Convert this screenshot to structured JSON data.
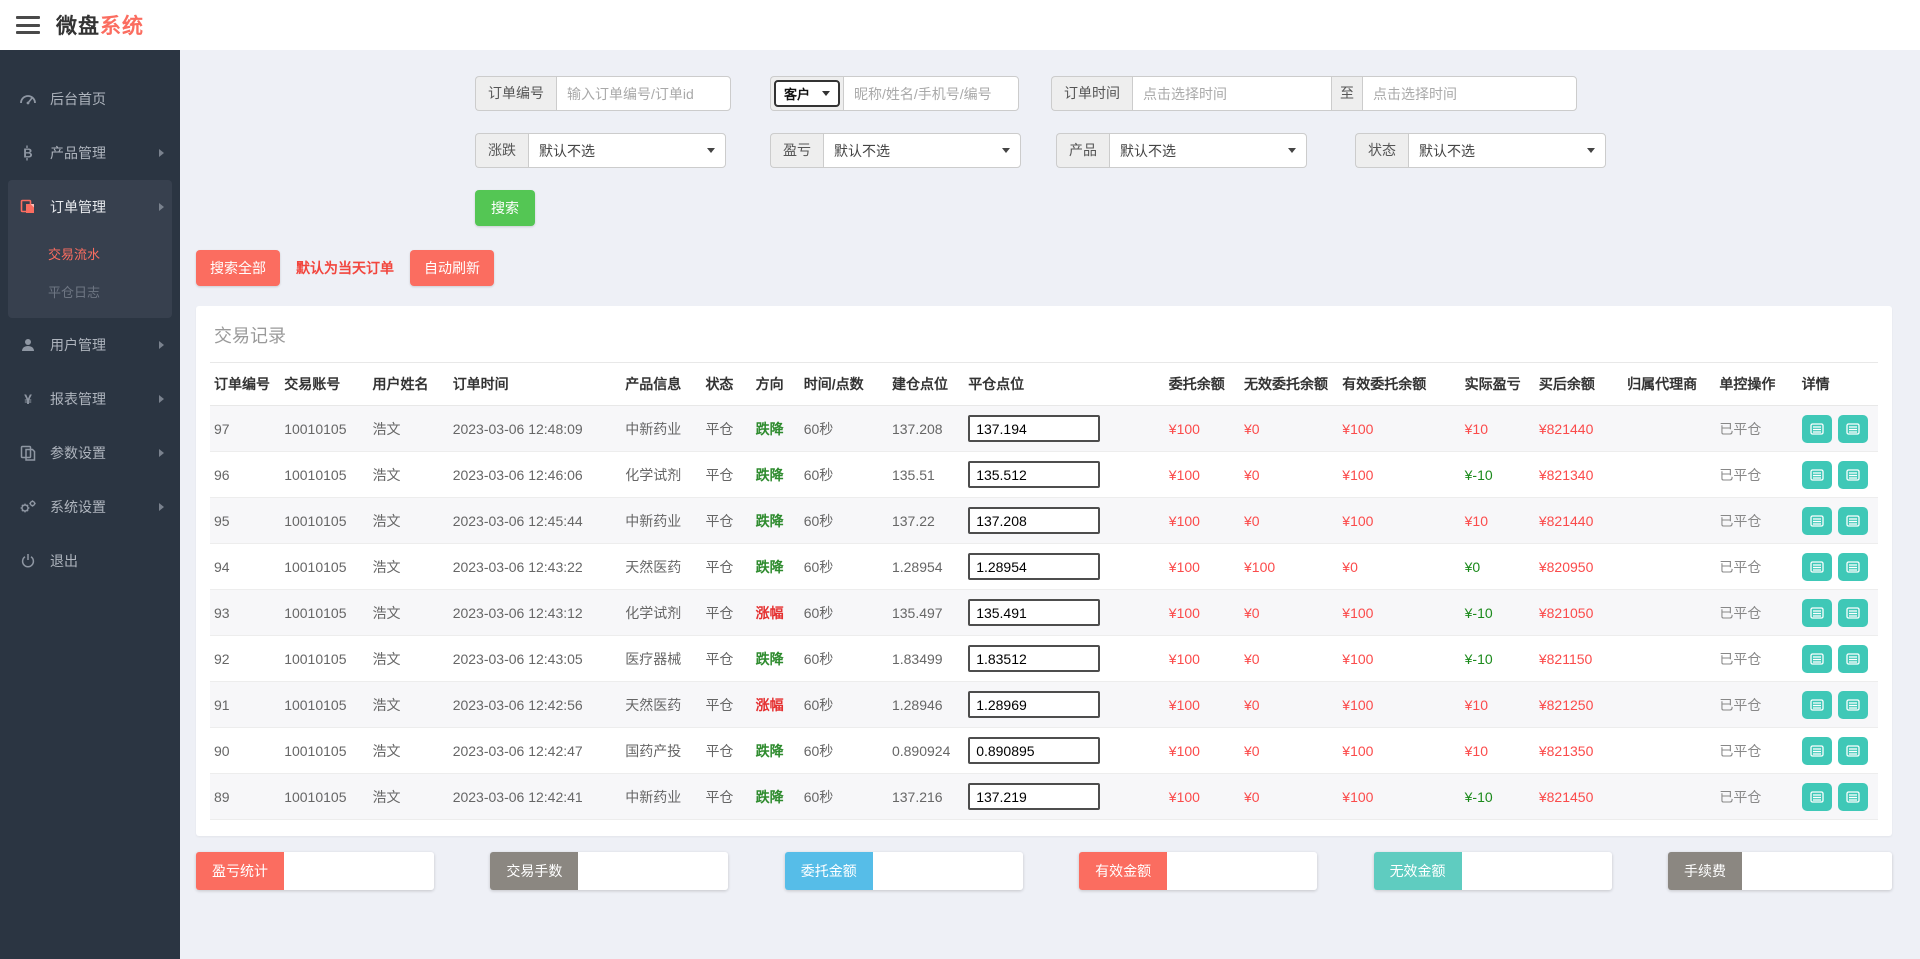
{
  "header": {
    "title_primary": "微盘",
    "title_accent": "系统"
  },
  "sidebar": {
    "items": [
      {
        "label": "后台首页",
        "icon": "dashboard-icon"
      },
      {
        "label": "产品管理",
        "icon": "bitcoin-icon"
      },
      {
        "label": "订单管理",
        "icon": "orders-icon"
      },
      {
        "label": "交易流水"
      },
      {
        "label": "平仓日志"
      },
      {
        "label": "用户管理",
        "icon": "user-icon"
      },
      {
        "label": "报表管理",
        "icon": "yen-icon"
      },
      {
        "label": "参数设置",
        "icon": "pages-icon"
      },
      {
        "label": "系统设置",
        "icon": "gears-icon"
      },
      {
        "label": "退出",
        "icon": "power-icon"
      }
    ]
  },
  "filters": {
    "order_no_label": "订单编号",
    "order_no_placeholder": "输入订单编号/订单id",
    "customer_select_value": "客户",
    "customer_placeholder": "昵称/姓名/手机号/编号",
    "order_time_label": "订单时间",
    "time_placeholder": "点击选择时间",
    "to_label": "至",
    "updown_label": "涨跌",
    "profit_label": "盈亏",
    "product_label": "产品",
    "status_label": "状态",
    "select_default": "默认不选",
    "search_button": "搜索"
  },
  "actions": {
    "search_all": "搜索全部",
    "note": "默认为当天订单",
    "auto_refresh": "自动刷新"
  },
  "table": {
    "title": "交易记录",
    "columns": [
      "订单编号",
      "交易账号",
      "用户姓名",
      "订单时间",
      "产品信息",
      "状态",
      "方向",
      "时间/点数",
      "建仓点位",
      "平仓点位",
      "委托余额",
      "无效委托余额",
      "有效委托余额",
      "实际盈亏",
      "买后余额",
      "归属代理商",
      "单控操作",
      "详情"
    ],
    "rows": [
      {
        "id": "97",
        "account": "10010105",
        "name": "浩文",
        "time": "2023-03-06 12:48:09",
        "product": "中新药业",
        "status": "平仓",
        "direction": "跌降",
        "direction_trend": "down",
        "duration": "60秒",
        "open": "137.208",
        "close": "137.194",
        "consign": "¥100",
        "invalid": "¥0",
        "valid": "¥100",
        "profit": "¥10",
        "profit_trend": "up",
        "after": "¥821440",
        "agent": "",
        "control": "已平仓"
      },
      {
        "id": "96",
        "account": "10010105",
        "name": "浩文",
        "time": "2023-03-06 12:46:06",
        "product": "化学试剂",
        "status": "平仓",
        "direction": "跌降",
        "direction_trend": "down",
        "duration": "60秒",
        "open": "135.51",
        "close": "135.512",
        "consign": "¥100",
        "invalid": "¥0",
        "valid": "¥100",
        "profit": "¥-10",
        "profit_trend": "down",
        "after": "¥821340",
        "agent": "",
        "control": "已平仓"
      },
      {
        "id": "95",
        "account": "10010105",
        "name": "浩文",
        "time": "2023-03-06 12:45:44",
        "product": "中新药业",
        "status": "平仓",
        "direction": "跌降",
        "direction_trend": "down",
        "duration": "60秒",
        "open": "137.22",
        "close": "137.208",
        "consign": "¥100",
        "invalid": "¥0",
        "valid": "¥100",
        "profit": "¥10",
        "profit_trend": "up",
        "after": "¥821440",
        "agent": "",
        "control": "已平仓"
      },
      {
        "id": "94",
        "account": "10010105",
        "name": "浩文",
        "time": "2023-03-06 12:43:22",
        "product": "天然医药",
        "status": "平仓",
        "direction": "跌降",
        "direction_trend": "down",
        "duration": "60秒",
        "open": "1.28954",
        "close": "1.28954",
        "consign": "¥100",
        "invalid": "¥100",
        "valid": "¥0",
        "profit": "¥0",
        "profit_trend": "down",
        "after": "¥820950",
        "agent": "",
        "control": "已平仓"
      },
      {
        "id": "93",
        "account": "10010105",
        "name": "浩文",
        "time": "2023-03-06 12:43:12",
        "product": "化学试剂",
        "status": "平仓",
        "direction": "涨幅",
        "direction_trend": "up",
        "duration": "60秒",
        "open": "135.497",
        "close": "135.491",
        "consign": "¥100",
        "invalid": "¥0",
        "valid": "¥100",
        "profit": "¥-10",
        "profit_trend": "down",
        "after": "¥821050",
        "agent": "",
        "control": "已平仓"
      },
      {
        "id": "92",
        "account": "10010105",
        "name": "浩文",
        "time": "2023-03-06 12:43:05",
        "product": "医疗器械",
        "status": "平仓",
        "direction": "跌降",
        "direction_trend": "down",
        "duration": "60秒",
        "open": "1.83499",
        "close": "1.83512",
        "consign": "¥100",
        "invalid": "¥0",
        "valid": "¥100",
        "profit": "¥-10",
        "profit_trend": "down",
        "after": "¥821150",
        "agent": "",
        "control": "已平仓"
      },
      {
        "id": "91",
        "account": "10010105",
        "name": "浩文",
        "time": "2023-03-06 12:42:56",
        "product": "天然医药",
        "status": "平仓",
        "direction": "涨幅",
        "direction_trend": "up",
        "duration": "60秒",
        "open": "1.28946",
        "close": "1.28969",
        "consign": "¥100",
        "invalid": "¥0",
        "valid": "¥100",
        "profit": "¥10",
        "profit_trend": "up",
        "after": "¥821250",
        "agent": "",
        "control": "已平仓"
      },
      {
        "id": "90",
        "account": "10010105",
        "name": "浩文",
        "time": "2023-03-06 12:42:47",
        "product": "国药产投",
        "status": "平仓",
        "direction": "跌降",
        "direction_trend": "down",
        "duration": "60秒",
        "open": "0.890924",
        "close": "0.890895",
        "consign": "¥100",
        "invalid": "¥0",
        "valid": "¥100",
        "profit": "¥10",
        "profit_trend": "up",
        "after": "¥821350",
        "agent": "",
        "control": "已平仓"
      },
      {
        "id": "89",
        "account": "10010105",
        "name": "浩文",
        "time": "2023-03-06 12:42:41",
        "product": "中新药业",
        "status": "平仓",
        "direction": "跌降",
        "direction_trend": "down",
        "duration": "60秒",
        "open": "137.216",
        "close": "137.219",
        "consign": "¥100",
        "invalid": "¥0",
        "valid": "¥100",
        "profit": "¥-10",
        "profit_trend": "down",
        "after": "¥821450",
        "agent": "",
        "control": "已平仓"
      }
    ]
  },
  "summary": [
    {
      "label": "盈亏统计",
      "color": "red"
    },
    {
      "label": "交易手数",
      "color": "gray"
    },
    {
      "label": "委托金额",
      "color": "blue"
    },
    {
      "label": "有效金额",
      "color": "red"
    },
    {
      "label": "无效金额",
      "color": "teal"
    },
    {
      "label": "手续费",
      "color": "gray"
    }
  ],
  "colors": {
    "accent_red": "#fb6d60",
    "green_button": "#54c654",
    "teal_button": "#3fc8b7",
    "info_blue": "#56bde8",
    "gray_label": "#8b8781",
    "money_red": "#fb4b4b",
    "money_green": "#1b8a1b",
    "direction_up": "#e53030",
    "direction_down": "#2e8b2e",
    "sidebar_bg": "#2b3542",
    "page_bg": "#eef0f6"
  }
}
